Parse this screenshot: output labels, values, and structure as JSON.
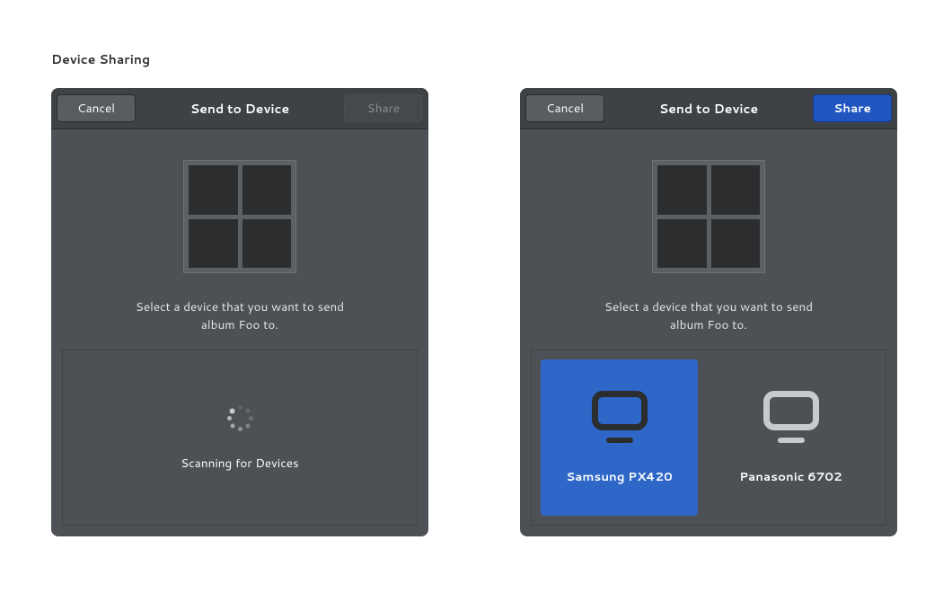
{
  "page_title": "Device Sharing",
  "dialog_left": {
    "cancel_label": "Cancel",
    "title": "Send to Device",
    "share_label": "Share",
    "prompt_line1": "Select a device that you want to send",
    "prompt_line2": "album Foo to.",
    "scanning_label": "Scanning for Devices"
  },
  "dialog_right": {
    "cancel_label": "Cancel",
    "title": "Send to Device",
    "share_label": "Share",
    "prompt_line1": "Select a device that you want to send",
    "prompt_line2": "album Foo to.",
    "devices": [
      {
        "name": "Samsung PX420",
        "selected": true
      },
      {
        "name": "Panasonic 6702",
        "selected": false
      }
    ]
  }
}
